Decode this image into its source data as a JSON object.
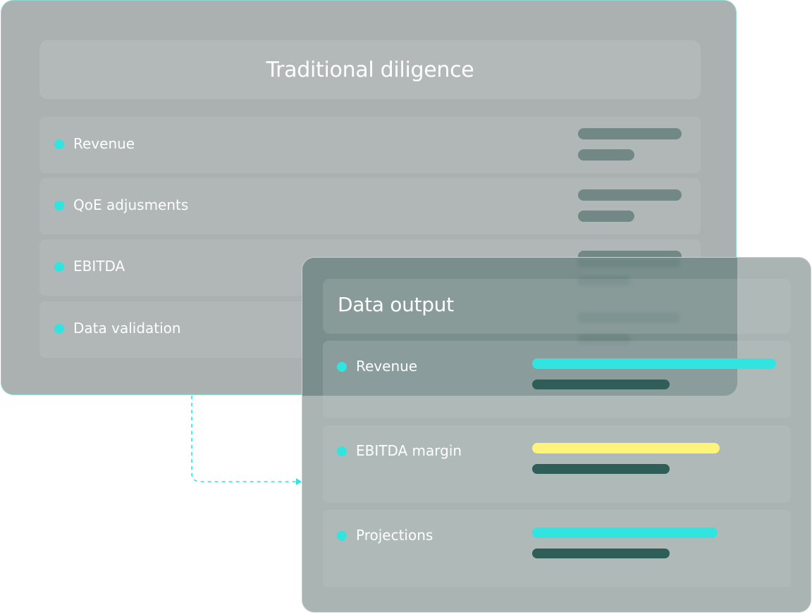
{
  "traditional": {
    "title": "Traditional diligence",
    "rows": [
      {
        "label": "Revenue"
      },
      {
        "label": "QoE adjusments"
      },
      {
        "label": "EBITDA"
      },
      {
        "label": "Data validation"
      }
    ]
  },
  "output": {
    "title": "Data output",
    "rows": [
      {
        "label": "Revenue",
        "bar_color": "#32e4e0",
        "level": 1.0
      },
      {
        "label": "EBITDA margin",
        "bar_color": "#fff47a",
        "level": 0.77
      },
      {
        "label": "Projections",
        "bar_color": "#32e4e0",
        "level": 0.76
      }
    ]
  },
  "colors": {
    "accent": "#32e4e0",
    "highlight": "#fff47a",
    "dark_bar": "#2f5e58",
    "connector": "#32e4e0"
  }
}
